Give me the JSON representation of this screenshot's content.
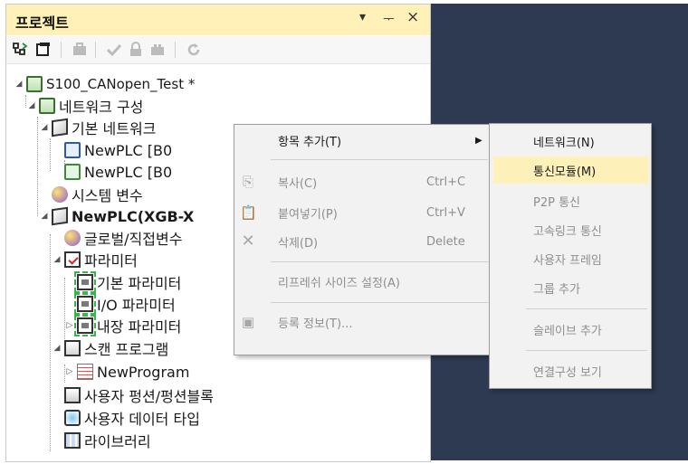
{
  "panel": {
    "title": "프로젝트",
    "pin_glyph": "▾",
    "dock_glyph": "ᅮ",
    "close_glyph": "×"
  },
  "toolbar": {
    "icons": [
      "project-tree-icon",
      "window-icon",
      "briefcase-icon",
      "check-icon",
      "lock-icon",
      "tools-icon",
      "refresh-icon"
    ]
  },
  "tree": {
    "root": "S100_CANopen_Test *",
    "network_config": "네트워크 구성",
    "basic_network": "기본 네트워크",
    "plc1": "NewPLC [B0",
    "plc2": "NewPLC [B0",
    "system_vars": "시스템 변수",
    "plc_main": "NewPLC(XGB-X",
    "global_vars": "글로벌/직접변수",
    "parameter": "파라미터",
    "basic_param": "기본 파라미터",
    "io_param": "I/O 파라미터",
    "builtin_param": "내장 파라미터",
    "scan_program": "스캔 프로그램",
    "new_program": "NewProgram",
    "user_function": "사용자 펑션/펑션블록",
    "user_data_type": "사용자 데이터 타입",
    "library": "라이브러리"
  },
  "context_menu": {
    "add_item": "항목 추가(T)",
    "copy": "복사(C)",
    "copy_shortcut": "Ctrl+C",
    "paste": "붙여넣기(P)",
    "paste_shortcut": "Ctrl+V",
    "delete": "삭제(D)",
    "delete_shortcut": "Delete",
    "refresh_size": "리프레쉬 사이즈 설정(A)",
    "register_info": "등록 정보(T)...",
    "submenu_arrow": "▶"
  },
  "submenu": {
    "network": "네트워크(N)",
    "comm_module": "통신모듈(M)",
    "p2p": "P2P 통신",
    "high_speed_link": "고속링크 통신",
    "user_frame": "사용자 프레임",
    "add_group": "그룹 추가",
    "add_slave": "슬레이브 추가",
    "view_connection": "연결구성 보기"
  },
  "colors": {
    "title_bar": "#fff1b8",
    "highlight": "#fdf0b8",
    "dark_area": "#2e3a52"
  }
}
